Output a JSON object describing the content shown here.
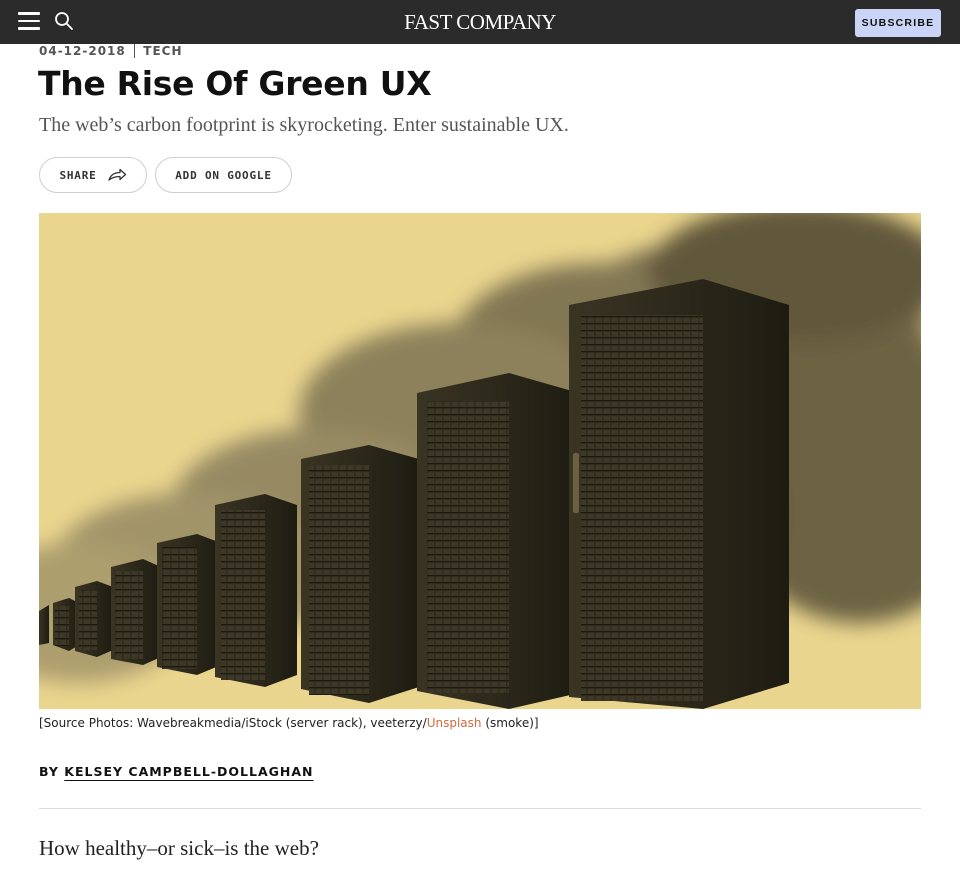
{
  "header": {
    "logo": "FAST COMPANY",
    "subscribe_label": "SUBSCRIBE"
  },
  "article": {
    "date": "04-12-2018",
    "category": "TECH",
    "title": "The Rise Of Green UX",
    "dek": "The web’s carbon footprint is skyrocketing. Enter sustainable UX.",
    "share_label": "SHARE",
    "google_label": "ADD ON GOOGLE",
    "caption": {
      "prefix": "[Source Photos: Wavebreakmedia/iStock (server rack), veeterzy/",
      "link": "Unsplash",
      "suffix": " (smoke)]"
    },
    "byline_prefix": "BY",
    "author": "KELSEY CAMPBELL-DOLLAGHAN",
    "lede": "How healthy–or sick–is the web?"
  },
  "icons": {
    "menu": "hamburger-menu-icon",
    "search": "search-icon",
    "share": "share-arrow-icon"
  },
  "colors": {
    "topbar": "#2b2b2b",
    "subscribe_bg": "#c9d4f7",
    "hero_bg": "#ead58e",
    "link_accent": "#d2683f"
  }
}
